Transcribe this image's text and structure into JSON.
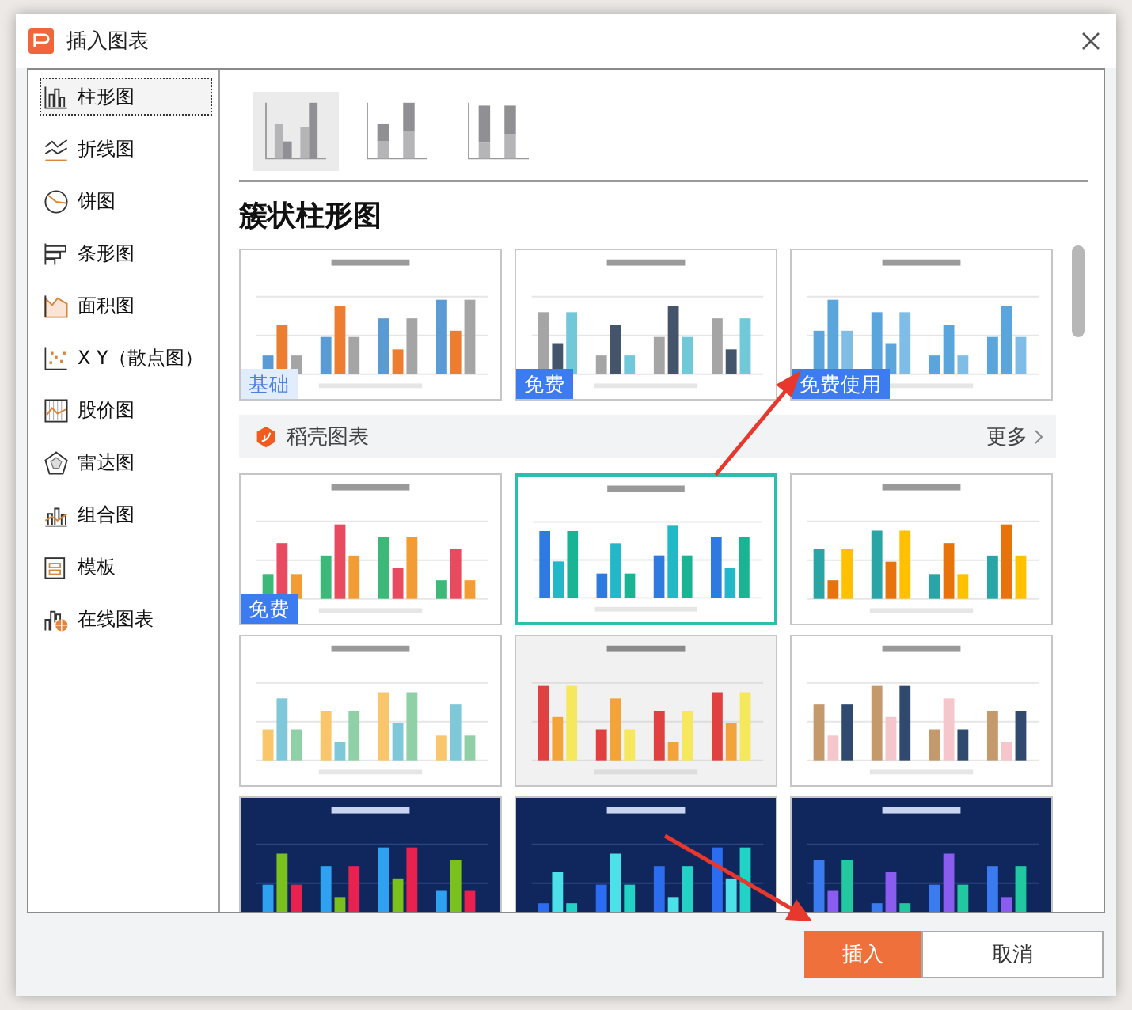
{
  "window": {
    "title": "插入图表"
  },
  "sidebar": {
    "items": [
      {
        "label": "柱形图",
        "kind": "column",
        "selected": true
      },
      {
        "label": "折线图",
        "kind": "line",
        "selected": false
      },
      {
        "label": "饼图",
        "kind": "pie",
        "selected": false
      },
      {
        "label": "条形图",
        "kind": "bar",
        "selected": false
      },
      {
        "label": "面积图",
        "kind": "area",
        "selected": false
      },
      {
        "label": "X Y（散点图）",
        "kind": "scatter",
        "selected": false
      },
      {
        "label": "股价图",
        "kind": "stock",
        "selected": false
      },
      {
        "label": "雷达图",
        "kind": "radar",
        "selected": false
      },
      {
        "label": "组合图",
        "kind": "combo",
        "selected": false
      },
      {
        "label": "模板",
        "kind": "template",
        "selected": false
      },
      {
        "label": "在线图表",
        "kind": "online",
        "selected": false
      }
    ]
  },
  "subtypes": [
    {
      "kind": "clustered",
      "selected": true
    },
    {
      "kind": "stacked",
      "selected": false
    },
    {
      "kind": "percent",
      "selected": false
    }
  ],
  "heading": "簇状柱形图",
  "basic_templates": [
    {
      "kind": "light",
      "selected": false,
      "badge": {
        "text": "基础",
        "kind": "basic"
      }
    },
    {
      "kind": "light",
      "selected": false,
      "badge": {
        "text": "免费",
        "kind": "free"
      }
    },
    {
      "kind": "light",
      "selected": false,
      "badge": {
        "text": "免费使用",
        "kind": "free"
      }
    }
  ],
  "docer_section": {
    "title": "稻壳图表",
    "more": "更多"
  },
  "docer_templates": [
    {
      "kind": "light",
      "selected": false,
      "badge": {
        "text": "免费",
        "kind": "free"
      }
    },
    {
      "kind": "light",
      "selected": true
    },
    {
      "kind": "light",
      "selected": false
    },
    {
      "kind": "light",
      "selected": false
    },
    {
      "kind": "grey",
      "selected": false
    },
    {
      "kind": "light",
      "selected": false
    },
    {
      "kind": "dark",
      "selected": false
    },
    {
      "kind": "dark",
      "selected": false
    },
    {
      "kind": "dark",
      "selected": false
    }
  ],
  "buttons": [
    {
      "label": "插入",
      "kind": "primary"
    },
    {
      "label": "取消",
      "kind": "secondary"
    }
  ]
}
